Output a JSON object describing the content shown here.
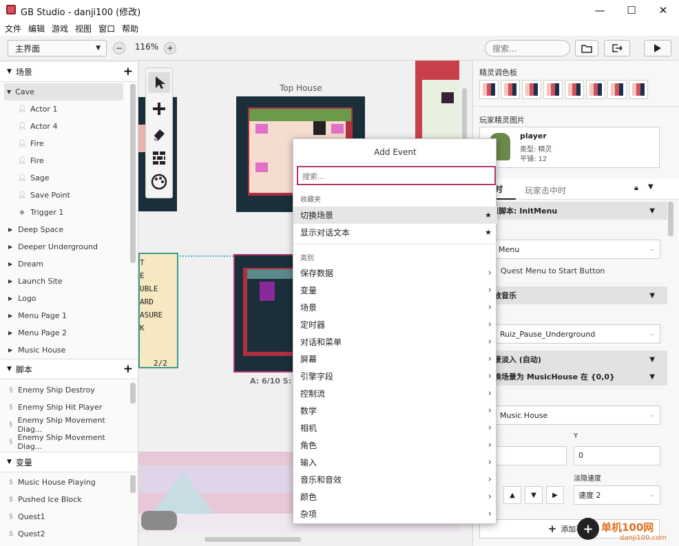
{
  "window": {
    "title": "GB Studio - danji100 (修改)",
    "minimize": "—",
    "maximize": "☐",
    "close": "✕"
  },
  "menu": [
    "文件",
    "编辑",
    "游戏",
    "视图",
    "窗口",
    "帮助"
  ],
  "toolbar": {
    "view_select": "主界面",
    "zoom_minus": "−",
    "zoom_value": "116%",
    "zoom_plus": "+",
    "search_placeholder": "搜索..."
  },
  "sidebar": {
    "scenes_label": "场景",
    "scripts_label": "脚本",
    "variables_label": "变量",
    "cave": "Cave",
    "cave_children": [
      "Actor 1",
      "Actor 4",
      "Fire",
      "Fire",
      "Sage",
      "Save Point",
      "Trigger 1"
    ],
    "scenes": [
      "Deep Space",
      "Deeper Underground",
      "Dream",
      "Launch Site",
      "Logo",
      "Menu Page 1",
      "Menu Page 2",
      "Music House"
    ],
    "scripts": [
      "Enemy Ship Destroy",
      "Enemy Ship Hit Player",
      "Enemy Ship Movement Diag...",
      "Enemy Ship Movement Diag..."
    ],
    "variables": [
      "Music House Playing",
      "Pushed Ice Block",
      "Quest1",
      "Quest2"
    ]
  },
  "canvas": {
    "top_house_label": "Top House",
    "scene_info": "A: 6/10   S:",
    "tile_text": [
      "T",
      "E",
      "UBLE",
      "ARD",
      "ASURE",
      "K",
      "2/2"
    ]
  },
  "context_menu": {
    "title": "Add Event",
    "search_placeholder": "搜索...",
    "favorites_label": "收藏夹",
    "favorites": [
      "切换场景",
      "显示对话文本"
    ],
    "categories_label": "类别",
    "categories": [
      "保存数据",
      "变量",
      "场景",
      "定时器",
      "对话和菜单",
      "屏幕",
      "引擎字段",
      "控制流",
      "数学",
      "相机",
      "角色",
      "输入",
      "音乐和音效",
      "颜色",
      "杂项"
    ]
  },
  "right_panel": {
    "palette_label": "精灵调色板",
    "player_sprite_label": "玩家精灵图片",
    "player_name": "player",
    "player_type": "类型: 精灵",
    "player_frames": "平铺: 12",
    "tab_active": "比时",
    "tab_other": "玩家击中时",
    "event1_title": "用脚本: InitMenu",
    "event1_select": "Menu",
    "event1_desc": "Quest Menu to Start Button",
    "event2_title": "放音乐",
    "event2_select": "Ruiz_Pause_Underground",
    "event3_title": "景淡入 (自动)",
    "event4_title": "换场景为 MusicHouse 在 {0,0}",
    "event4_select": "Music House",
    "y_label": "Y",
    "y_value": "0",
    "x_value": "",
    "fade_label": "淡隐速度",
    "fade_value": "速度 2",
    "add_event": "添加事件"
  },
  "watermark": {
    "site": "单机100网",
    "url": "danji100.com"
  },
  "colors": {
    "accent": "#b8336a",
    "scene_border": "#b03040",
    "dark_bg": "#1a2f3a"
  }
}
